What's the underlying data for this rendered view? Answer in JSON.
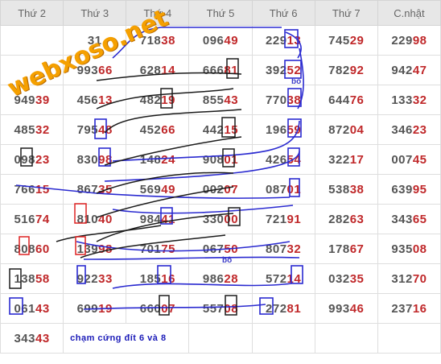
{
  "watermark": "webxoso.net",
  "colors": {
    "header_bg": "#e7e7e7",
    "tail": "#c0282a",
    "digits": "#555555",
    "marker": "#1a1ab8",
    "watermark": "#f5a000"
  },
  "headers": [
    "Thứ 2",
    "Thứ 3",
    "Thứ 4",
    "Thứ 5",
    "Thứ 6",
    "Thứ 7",
    "C.nhật"
  ],
  "rows": [
    [
      "",
      "31",
      "71838",
      "09649",
      "22913",
      "74529",
      "22998"
    ],
    [
      "",
      "99366",
      "62814",
      "66681",
      "39252",
      "78292",
      "94247"
    ],
    [
      "94939",
      "45613",
      "48219",
      "85543",
      "77038",
      "64476",
      "13332"
    ],
    [
      "48532",
      "79548",
      "45266",
      "44215",
      "19659",
      "87204",
      "34623"
    ],
    [
      "09823",
      "83098",
      "14824",
      "90801",
      "42654",
      "32217",
      "00745"
    ],
    [
      "76615",
      "86735",
      "56949",
      "00207",
      "08701",
      "53838",
      "63995"
    ],
    [
      "51674",
      "81040",
      "98441",
      "33000",
      "72191",
      "28263",
      "34365"
    ],
    [
      "80860",
      "13998",
      "70175",
      "06750",
      "80732",
      "17867",
      "93508"
    ],
    [
      "13858",
      "92233",
      "18516",
      "98628",
      "57214",
      "03235",
      "31270"
    ],
    [
      "06143",
      "69919",
      "66007",
      "55708",
      "27281",
      "99346",
      "23716"
    ]
  ],
  "last_row": {
    "value": "34343",
    "note": "chạm cứng đít 6 và 8"
  },
  "annotations": [
    "bỏ",
    "bỏ"
  ]
}
